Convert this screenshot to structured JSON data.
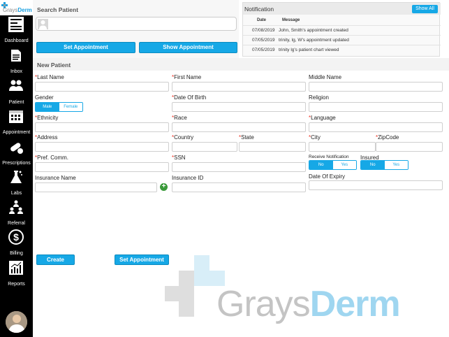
{
  "app": {
    "logo_light": "Grays",
    "logo_bold": "Derm"
  },
  "colors": {
    "accent": "#16a8e6",
    "sidebar": "#000000",
    "required": "#e33322"
  },
  "sidebar": {
    "items": [
      {
        "label": "Dashboard",
        "icon": "dashboard-icon"
      },
      {
        "label": "Inbox",
        "icon": "inbox-icon"
      },
      {
        "label": "Patient",
        "icon": "patients-icon"
      },
      {
        "label": "Appointment",
        "icon": "calendar-icon"
      },
      {
        "label": "Prescriptions",
        "icon": "pills-icon"
      },
      {
        "label": "Labs",
        "icon": "flask-icon"
      },
      {
        "label": "Referral",
        "icon": "referral-icon"
      },
      {
        "label": "Billing",
        "icon": "dollar-icon"
      },
      {
        "label": "Reports",
        "icon": "chart-icon"
      }
    ]
  },
  "search": {
    "title": "Search Patient",
    "placeholder": "",
    "set_appointment": "Set Appointment",
    "show_appointment": "Show Appointment"
  },
  "notification": {
    "title": "Notification",
    "show_all": "Show All",
    "col_date": "Date",
    "col_message": "Message",
    "rows": [
      {
        "date": "07/08/2019",
        "message": "John, Smith's appointment created"
      },
      {
        "date": "07/05/2019",
        "message": "trinity, lg, W's appointment updated"
      },
      {
        "date": "07/05/2019",
        "message": "trinity lg's patient chart viewed"
      }
    ]
  },
  "new_patient": {
    "title": "New Patient",
    "last_name": "Last Name",
    "first_name": "First Name",
    "middle_name": "Middle Name",
    "gender": "Gender",
    "gender_male": "Male",
    "gender_female": "Female",
    "dob": "Date Of Birth",
    "religion": "Religion",
    "ethnicity": "Ethnicity",
    "race": "Race",
    "language": "Language",
    "address": "Address",
    "country": "Country",
    "state": "State",
    "city": "City",
    "zipcode": "ZipCode",
    "pref_comm": "Pref. Comm.",
    "ssn": "SSN",
    "receive_notification": "Receive Notification",
    "insured": "Insured",
    "no": "No",
    "yes": "Yes",
    "insurance_name": "Insurance Name",
    "insurance_id": "Insurance ID",
    "date_of_expiry": "Date Of Expiry",
    "required_mark": "*"
  },
  "actions": {
    "create": "Create",
    "set_appointment": "Set Appointment"
  },
  "watermark": {
    "light": "Grays",
    "bold": "Derm"
  }
}
